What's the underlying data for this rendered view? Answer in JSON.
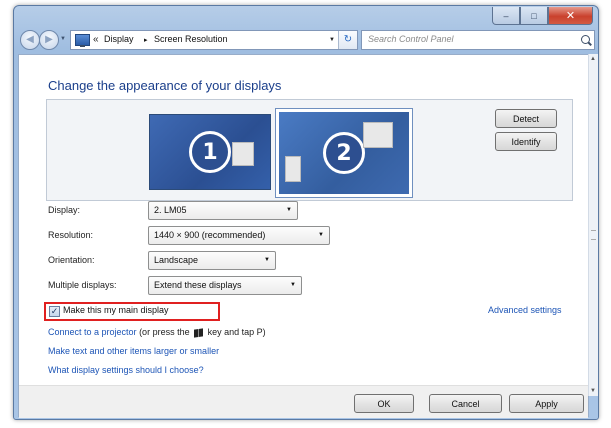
{
  "window": {
    "minimize_glyph": "–",
    "maximize_glyph": "□",
    "close_glyph": "✕"
  },
  "nav": {
    "back_glyph": "◀",
    "forward_glyph": "▶",
    "history_glyph": "▼",
    "address_chevron": "«",
    "breadcrumb": [
      "Display",
      "Screen Resolution"
    ],
    "breadcrumb_separator": "▸",
    "address_dropdown_glyph": "▼",
    "refresh_glyph": "↻",
    "search_placeholder": "Search Control Panel",
    "address_icon": "control-panel-icon"
  },
  "main": {
    "heading": "Change the appearance of your displays",
    "monitors": [
      {
        "number": "1",
        "selected": false
      },
      {
        "number": "2",
        "selected": true
      }
    ],
    "detect_label": "Detect",
    "identify_label": "Identify"
  },
  "settings": {
    "display_label": "Display:",
    "display_value": "2. LM05",
    "resolution_label": "Resolution:",
    "resolution_value": "1440 × 900 (recommended)",
    "orientation_label": "Orientation:",
    "orientation_value": "Landscape",
    "multiple_label": "Multiple displays:",
    "multiple_value": "Extend these displays",
    "dropdown_glyph": "▼"
  },
  "main_display": {
    "label": "Make this my main display",
    "checked": true,
    "check_glyph": "✓"
  },
  "links": {
    "advanced": "Advanced settings",
    "projector_link": "Connect to a projector",
    "projector_hint_before": " (or press the ",
    "projector_hint_after": " key and tap P)",
    "text_size": "Make text and other items larger or smaller",
    "help": "What display settings should I choose?"
  },
  "footer": {
    "ok_label": "OK",
    "cancel_label": "Cancel",
    "apply_label": "Apply"
  },
  "scroll": {
    "up_glyph": "▲",
    "down_glyph": "▼"
  },
  "colors": {
    "heading": "#1b3f8b",
    "link": "#1d55b6",
    "highlight_border": "#e02020",
    "monitor_blue": "#3460aa"
  }
}
